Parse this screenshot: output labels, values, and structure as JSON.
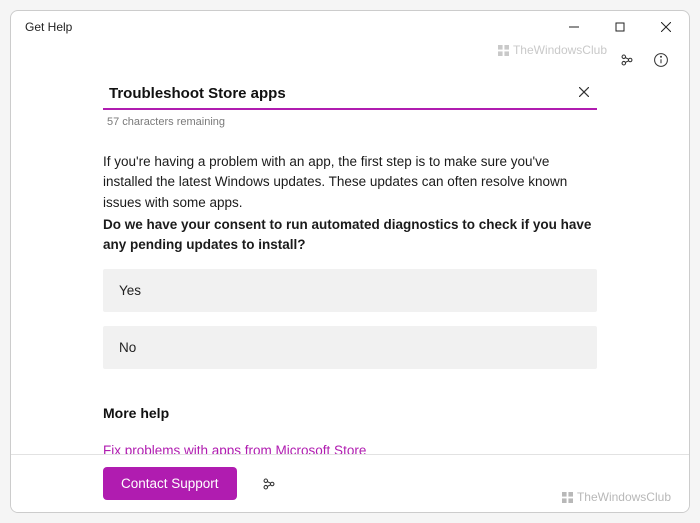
{
  "window": {
    "title": "Get Help"
  },
  "search": {
    "value": "Troubleshoot Store apps",
    "char_remaining": "57 characters remaining"
  },
  "body": {
    "intro": "If you're having a problem with an app, the first step is to make sure you've installed the latest Windows updates. These updates can often resolve known issues with some apps.",
    "consent": "Do we have your consent to run automated diagnostics to check if you have any pending updates to install?"
  },
  "options": {
    "yes": "Yes",
    "no": "No"
  },
  "more_help": {
    "heading": "More help",
    "link": "Fix problems with apps from Microsoft Store"
  },
  "footer": {
    "contact": "Contact Support"
  },
  "watermark": "TheWindowsClub"
}
